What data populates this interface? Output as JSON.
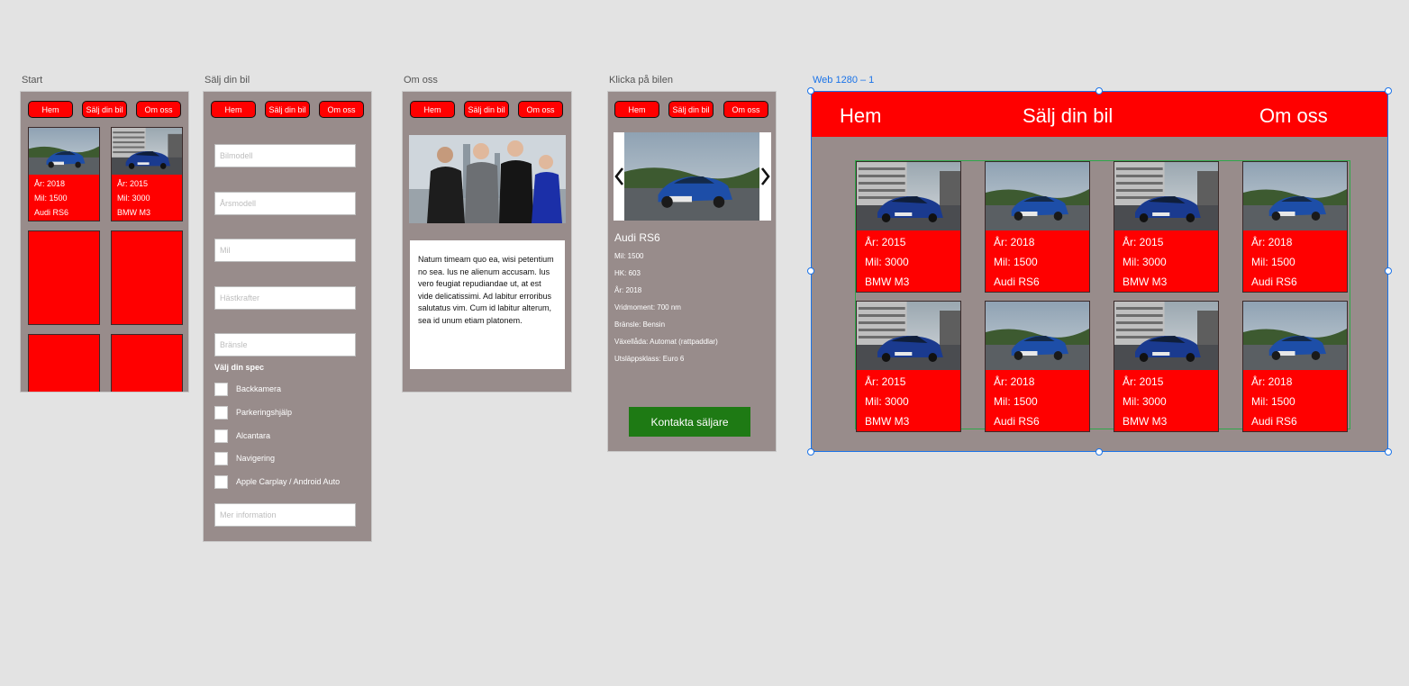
{
  "artboards": {
    "start": "Start",
    "salj": "Sälj din bil",
    "omoss": "Om oss",
    "klicka": "Klicka på bilen",
    "web": "Web 1280 – 1"
  },
  "nav": {
    "hem": "Hem",
    "salj": "Sälj din bil",
    "omoss": "Om oss"
  },
  "start_cards": [
    {
      "year": "År: 2018",
      "miles": "Mil: 1500",
      "model": "Audi RS6"
    },
    {
      "year": "År: 2015",
      "miles": "Mil: 3000",
      "model": "BMW M3"
    }
  ],
  "form": {
    "fields": [
      "Bilmodell",
      "Årsmodell",
      "Mil",
      "Hästkrafter",
      "Bränsle"
    ],
    "spec_heading": "Välj din spec",
    "options": [
      "Backkamera",
      "Parkeringshjälp",
      "Alcantara",
      "Navigering",
      "Apple Carplay / Android Auto"
    ],
    "more_info_placeholder": "Mer information"
  },
  "about": {
    "text": "Natum timeam quo ea, wisi petentium no sea. Ius ne alienum accusam. Ius vero feugiat repudiandae ut, at est vide delicatissimi. Ad labitur erroribus salutatus vim. Cum id labitur alterum, sea id unum etiam platonem."
  },
  "detail": {
    "title": "Audi RS6",
    "lines": [
      "Mil: 1500",
      "HK: 603",
      "År: 2018",
      "Vridmoment: 700 nm",
      "Bränsle: Bensin",
      "Växellåda: Automat (rattpaddlar)",
      "Utsläppsklass: Euro 6"
    ],
    "contact_button": "Kontakta säljare",
    "prev_icon": "chevron-left-icon",
    "next_icon": "chevron-right-icon"
  },
  "web": {
    "nav": {
      "hem": "Hem",
      "salj": "Sälj din bil",
      "omoss": "Om oss"
    },
    "cards": [
      {
        "year": "År: 2015",
        "miles": "Mil: 3000",
        "model": "BMW M3",
        "car": "bmw"
      },
      {
        "year": "År: 2018",
        "miles": "Mil: 1500",
        "model": "Audi RS6",
        "car": "audi"
      },
      {
        "year": "År: 2015",
        "miles": "Mil: 3000",
        "model": "BMW M3",
        "car": "bmw"
      },
      {
        "year": "År: 2018",
        "miles": "Mil: 1500",
        "model": "Audi RS6",
        "car": "audi"
      },
      {
        "year": "År: 2015",
        "miles": "Mil: 3000",
        "model": "BMW M3",
        "car": "bmw"
      },
      {
        "year": "År: 2018",
        "miles": "Mil: 1500",
        "model": "Audi RS6",
        "car": "audi"
      },
      {
        "year": "År: 2015",
        "miles": "Mil: 3000",
        "model": "BMW M3",
        "car": "bmw"
      },
      {
        "year": "År: 2018",
        "miles": "Mil: 1500",
        "model": "Audi RS6",
        "car": "audi"
      }
    ]
  },
  "colors": {
    "background": "#e3e3e3",
    "panel": "#988c8b",
    "accent_red": "#ff0000",
    "contact_green": "#1e7a14",
    "selection_blue": "#1a73e8"
  }
}
